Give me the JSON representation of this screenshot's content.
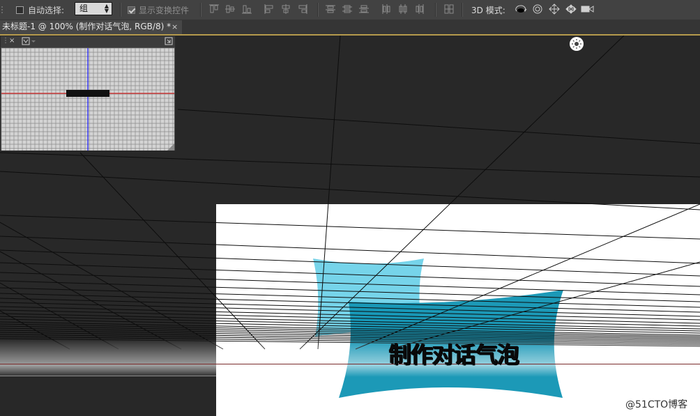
{
  "options_bar": {
    "auto_select_label": "自动选择:",
    "auto_select_checked": false,
    "auto_select_target": "组",
    "show_transform_label": "显示变换控件",
    "show_transform_checked": true,
    "mode_3d_label": "3D 模式:",
    "align_icons": [
      "align-top-edges-icon",
      "align-vertical-centers-icon",
      "align-bottom-edges-icon",
      "align-left-edges-icon",
      "align-horizontal-centers-icon",
      "align-right-edges-icon"
    ],
    "distribute_icons": [
      "distribute-top-icon",
      "distribute-vertical-centers-icon",
      "distribute-bottom-icon",
      "distribute-left-icon",
      "distribute-horizontal-centers-icon",
      "distribute-right-icon",
      "auto-align-layers-icon"
    ],
    "mode_3d_icons": [
      "rotate-3d-icon",
      "roll-3d-icon",
      "drag-3d-icon",
      "slide-3d-icon",
      "scale-3d-camera-icon"
    ]
  },
  "document_tab": {
    "title": "未标题-1 @ 100% (制作对话气泡, RGB/8) *",
    "close_glyph": "×"
  },
  "navigator": {
    "close_glyph": "×",
    "colors": {
      "grid": "#8a8a8a",
      "vertical_axis": "#1a1aff",
      "horizontal_axis": "#d02020"
    }
  },
  "canvas": {
    "headline": "制作对话气泡",
    "colors": {
      "light_bubble": "#76d4ea",
      "dark_bubble": "#1596b5",
      "grid_line": "#0d0d0d",
      "background": "#ffffff"
    }
  },
  "watermark": "@51CTO博客"
}
